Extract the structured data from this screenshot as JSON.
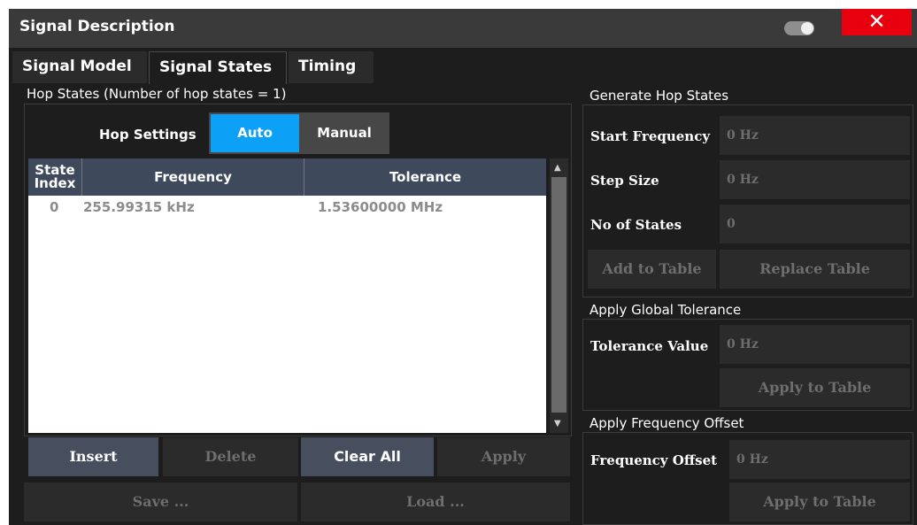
{
  "window": {
    "title": "Signal Description",
    "close_glyph": "✕"
  },
  "tabs": [
    {
      "label": "Signal Model"
    },
    {
      "label": "Signal States"
    },
    {
      "label": "Timing"
    }
  ],
  "hop_states": {
    "title": "Hop States (Number of hop states = 1)",
    "hop_settings_label": "Hop Settings",
    "options": {
      "auto": "Auto",
      "manual": "Manual"
    },
    "selected": "Auto",
    "table": {
      "headers": {
        "index": "State\nIndex",
        "frequency": "Frequency",
        "tolerance": "Tolerance"
      },
      "rows": [
        {
          "index": "0",
          "frequency": "255.99315 kHz",
          "tolerance": "1.53600000 MHz"
        }
      ]
    },
    "buttons": {
      "insert": "Insert",
      "delete": "Delete",
      "clear_all": "Clear All",
      "apply": "Apply",
      "save": "Save ...",
      "load": "Load ..."
    }
  },
  "generate_hop_states": {
    "title": "Generate Hop States",
    "start_frequency": {
      "label": "Start Frequency",
      "value": "0 Hz"
    },
    "step_size": {
      "label": "Step Size",
      "value": "0 Hz"
    },
    "no_of_states": {
      "label": "No of States",
      "value": "0"
    },
    "add_to_table": "Add to Table",
    "replace_table": "Replace Table"
  },
  "global_tolerance": {
    "title": "Apply Global Tolerance",
    "tolerance_value": {
      "label": "Tolerance Value",
      "value": "0 Hz"
    },
    "apply_to_table": "Apply to Table"
  },
  "frequency_offset": {
    "title": "Apply Frequency Offset",
    "offset": {
      "label": "Frequency Offset",
      "value": "0 Hz"
    },
    "apply_to_table": "Apply to Table"
  },
  "colors": {
    "accent": "#0ca0f7",
    "close": "#e9000f",
    "header": "#3e4a5c"
  }
}
